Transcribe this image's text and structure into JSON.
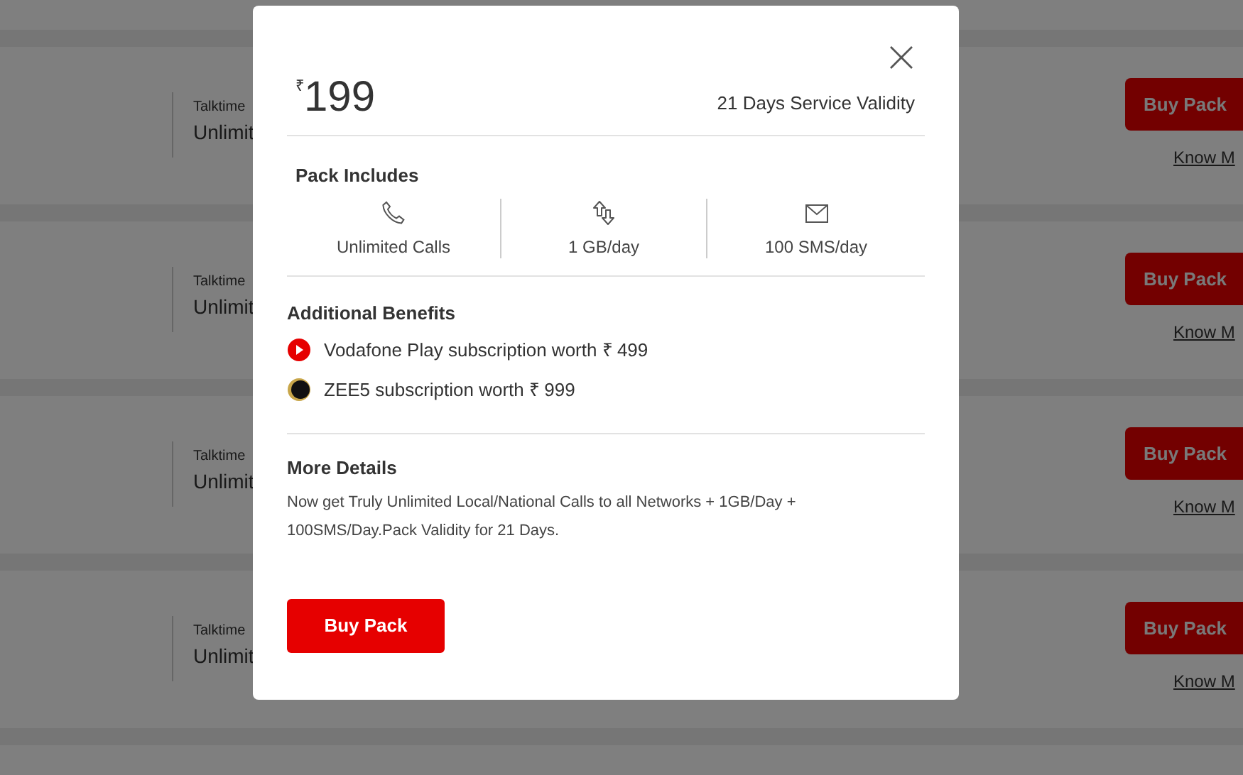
{
  "packs": [
    {
      "label": "Talktime",
      "value": "Unlimit",
      "button": "Buy Pack",
      "link": "Know M"
    },
    {
      "label": "Talktime",
      "value": "Unlimit",
      "button": "Buy Pack",
      "link": "Know M"
    },
    {
      "label": "Talktime",
      "value": "Unlimit",
      "button": "Buy Pack",
      "link": "Know M"
    },
    {
      "label": "Talktime",
      "value": "Unlimit",
      "button": "Buy Pack",
      "link": "Know M"
    }
  ],
  "modal": {
    "currency": "₹",
    "price": "199",
    "validity": "21 Days Service Validity",
    "includes_heading": "Pack Includes",
    "includes": [
      {
        "kind": "calls",
        "label": "Unlimited Calls"
      },
      {
        "kind": "data",
        "label": "1 GB/day"
      },
      {
        "kind": "sms",
        "label": "100 SMS/day"
      }
    ],
    "benefits_heading": "Additional Benefits",
    "benefits": [
      {
        "kind": "play",
        "text": "Vodafone Play subscription worth ₹ 499"
      },
      {
        "kind": "zee5",
        "text": "ZEE5 subscription worth ₹ 999"
      }
    ],
    "details_heading": "More Details",
    "details": "Now get Truly Unlimited Local/National Calls to all Networks + 1GB/Day + 100SMS/Day.Pack Validity for 21 Days.",
    "button": "Buy Pack"
  }
}
